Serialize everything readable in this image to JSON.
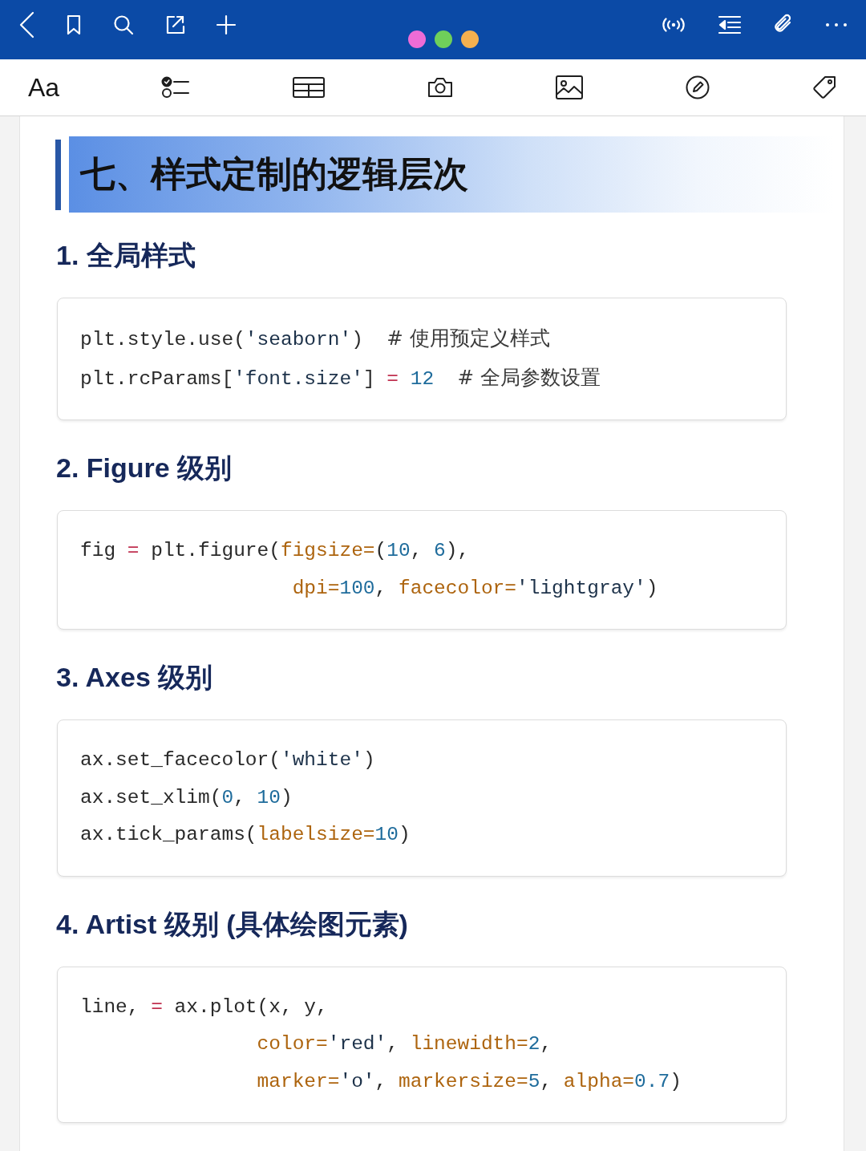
{
  "top_bar": {
    "color_dots": [
      {
        "color": "#ee6cd6"
      },
      {
        "color": "#6fcf5a"
      },
      {
        "color": "#f5b04f"
      }
    ]
  },
  "format_toolbar": {
    "text_button": "Aa"
  },
  "document": {
    "title": "七、样式定制的逻辑层次",
    "sections": [
      {
        "heading": "1. 全局样式",
        "code": [
          {
            "tokens": [
              {
                "kind": "plain",
                "text": "plt.style.use("
              },
              {
                "kind": "string",
                "text": "'seaborn'"
              },
              {
                "kind": "plain",
                "text": ")  "
              },
              {
                "kind": "comment",
                "text": "# 使用预定义样式"
              }
            ]
          },
          {
            "tokens": [
              {
                "kind": "plain",
                "text": "plt.rcParams["
              },
              {
                "kind": "string",
                "text": "'font.size'"
              },
              {
                "kind": "plain",
                "text": "] "
              },
              {
                "kind": "op",
                "text": "= "
              },
              {
                "kind": "number",
                "text": "12  "
              },
              {
                "kind": "comment",
                "text": "# 全局参数设置"
              }
            ]
          }
        ]
      },
      {
        "heading": "2. Figure 级别",
        "code": [
          {
            "tokens": [
              {
                "kind": "plain",
                "text": "fig "
              },
              {
                "kind": "op",
                "text": "="
              },
              {
                "kind": "plain",
                "text": " plt.figure("
              },
              {
                "kind": "param",
                "text": "figsize="
              },
              {
                "kind": "plain",
                "text": "("
              },
              {
                "kind": "number",
                "text": "10"
              },
              {
                "kind": "plain",
                "text": ", "
              },
              {
                "kind": "number",
                "text": "6"
              },
              {
                "kind": "plain",
                "text": "),"
              }
            ]
          },
          {
            "tokens": [
              {
                "kind": "param",
                "text": "                  dpi="
              },
              {
                "kind": "number",
                "text": "100"
              },
              {
                "kind": "plain",
                "text": ", "
              },
              {
                "kind": "param",
                "text": "facecolor="
              },
              {
                "kind": "string",
                "text": "'lightgray'"
              },
              {
                "kind": "plain",
                "text": ")"
              }
            ]
          }
        ]
      },
      {
        "heading": "3. Axes 级别",
        "code": [
          {
            "tokens": [
              {
                "kind": "plain",
                "text": "ax.set_facecolor("
              },
              {
                "kind": "string",
                "text": "'white'"
              },
              {
                "kind": "plain",
                "text": ")"
              }
            ]
          },
          {
            "tokens": [
              {
                "kind": "plain",
                "text": "ax.set_xlim("
              },
              {
                "kind": "number",
                "text": "0"
              },
              {
                "kind": "plain",
                "text": ", "
              },
              {
                "kind": "number",
                "text": "10"
              },
              {
                "kind": "plain",
                "text": ")"
              }
            ]
          },
          {
            "tokens": [
              {
                "kind": "plain",
                "text": "ax.tick_params("
              },
              {
                "kind": "param",
                "text": "labelsize="
              },
              {
                "kind": "number",
                "text": "10"
              },
              {
                "kind": "plain",
                "text": ")"
              }
            ]
          }
        ]
      },
      {
        "heading": "4. Artist 级别 (具体绘图元素)",
        "code": [
          {
            "tokens": [
              {
                "kind": "plain",
                "text": "line, "
              },
              {
                "kind": "op",
                "text": "="
              },
              {
                "kind": "plain",
                "text": " ax.plot(x, y,"
              }
            ]
          },
          {
            "tokens": [
              {
                "kind": "param",
                "text": "               color="
              },
              {
                "kind": "string",
                "text": "'red'"
              },
              {
                "kind": "plain",
                "text": ", "
              },
              {
                "kind": "param",
                "text": "linewidth="
              },
              {
                "kind": "number",
                "text": "2"
              },
              {
                "kind": "plain",
                "text": ","
              }
            ]
          },
          {
            "tokens": [
              {
                "kind": "param",
                "text": "               marker="
              },
              {
                "kind": "string",
                "text": "'o'"
              },
              {
                "kind": "plain",
                "text": ", "
              },
              {
                "kind": "param",
                "text": "markersize="
              },
              {
                "kind": "number",
                "text": "5"
              },
              {
                "kind": "plain",
                "text": ", "
              },
              {
                "kind": "param",
                "text": "alpha="
              },
              {
                "kind": "number",
                "text": "0.7"
              },
              {
                "kind": "plain",
                "text": ")"
              }
            ]
          }
        ]
      }
    ]
  }
}
